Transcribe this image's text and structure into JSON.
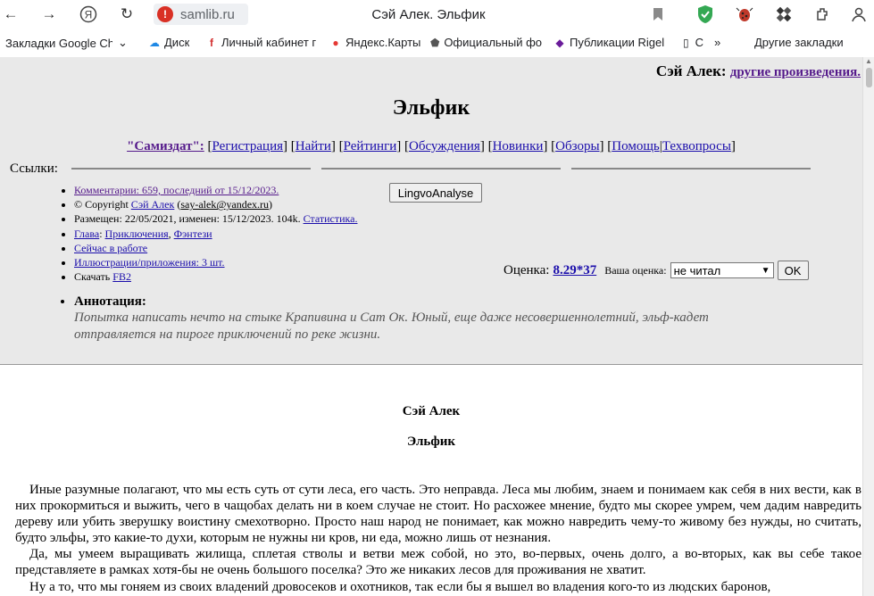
{
  "browser": {
    "url": "samlib.ru",
    "window_title": "Сэй Алек. Эльфик",
    "bookmarks": [
      "Закладки Google Chr",
      "Диск",
      "Личный кабинет г",
      "Яндекс.Карты",
      "Официальный фо",
      "Публикации Rigel",
      "С",
      "Другие закладки"
    ]
  },
  "page": {
    "author_name": "Сэй Алек:",
    "other_works": "другие произведения.",
    "title": "Эльфик",
    "nav": {
      "samizdat": "\"Самиздат\":",
      "items": [
        "Регистрация",
        "Найти",
        "Рейтинги",
        "Обсуждения",
        "Новинки",
        "Обзоры",
        "Помощь",
        "Техвопросы"
      ]
    },
    "links_label": "Ссылки:",
    "info": {
      "comments": "Комментарии: 659, последний от 15/12/2023.",
      "copyright_prefix": "© Copyright ",
      "copyright_author": "Сэй Алек",
      "email": "say-alek@yandex.ru",
      "posted": "Размещен: 22/05/2021, изменен: 15/12/2023. 104k. ",
      "stats": "Статистика.",
      "chapter": "Глава",
      "genre1": "Приключения",
      "genre2": "Фэнтези",
      "in_work": "Сейчас в работе",
      "illustrations": "Иллюстрации/приложения: 3 шт.",
      "download": "Скачать ",
      "fb2": "FB2"
    },
    "lingvo_button": "LingvoAnalyse",
    "rating": {
      "label": "Оценка:",
      "value": "8.29*37",
      "your_label": "Ваша оценка:",
      "selected": "не читал",
      "ok": "OK"
    },
    "annotation": {
      "title": "Аннотация:",
      "text": "Попытка написать нечто на стыке Крапивина и Сат Ок. Юный, еще даже несовершеннолетний, эльф-кадет отправляется на пироге приключений по реке жизни."
    },
    "content": {
      "author": "Сэй Алек",
      "title": "Эльфик",
      "paragraphs": [
        "Иные разумные полагают, что мы есть суть от сути леса, его часть. Это неправда. Леса мы любим, знаем и понимаем как себя в них вести, как в них прокормиться и выжить, чего в чащобах делать ни в коем случае не стоит. Но расхожее мнение, будто мы скорее умрем, чем дадим навредить дереву или убить зверушку воистину смехотворно. Просто наш народ не понимает, как можно навредить чему-то живому без нужды, но считать, будто эльфы, это какие-то духи, которым не нужны ни кров, ни еда, можно лишь от незнания.",
        "Да, мы умеем выращивать жилища, сплетая стволы и ветви меж собой, но это, во-первых, очень долго, а во-вторых, как вы себе такое представляете в рамках хотя-бы не очень большого поселка? Это же никаких лесов для проживания не хватит.",
        "Ну а то, что мы гоняем из своих владений дровосеков и охотников, так если бы я вышел во владения кого-то из людских баронов,"
      ]
    }
  }
}
